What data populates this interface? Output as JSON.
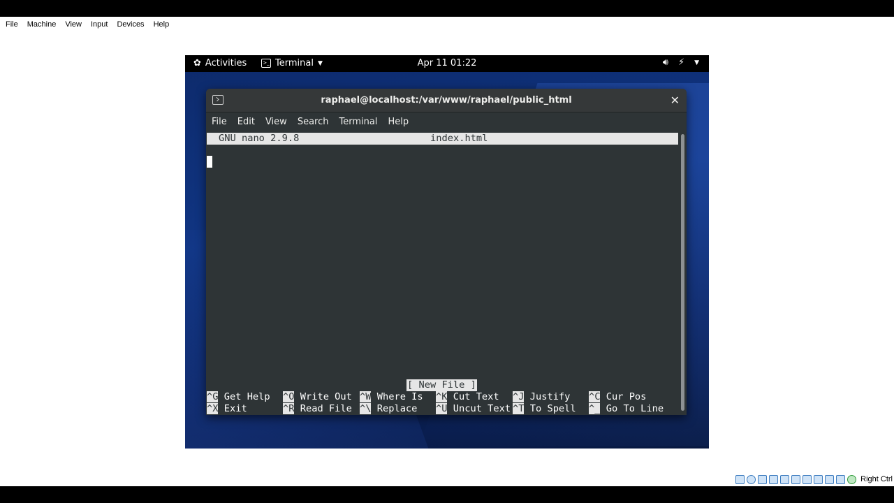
{
  "host_window": {
    "menu": [
      "File",
      "Machine",
      "View",
      "Input",
      "Devices",
      "Help"
    ],
    "status_icons": [
      "hard-disk-icon",
      "optical-drive-icon",
      "audio-icon",
      "network-icon",
      "usb-icon",
      "shared-folders-icon",
      "display-icon",
      "video-capture-icon",
      "keyboard-icon",
      "mouse-integration-icon",
      "green-indicator-icon"
    ],
    "host_key_label": "Right Ctrl"
  },
  "gnome_topbar": {
    "activities": "Activities",
    "app_menu": "Terminal",
    "clock": "Apr 11  01:22",
    "tray_icons": [
      "volume-icon",
      "power-icon",
      "dropdown-arrow-icon"
    ]
  },
  "terminal": {
    "title": "raphael@localhost:/var/www/raphael/public_html",
    "menu": [
      "File",
      "Edit",
      "View",
      "Search",
      "Terminal",
      "Help"
    ]
  },
  "nano": {
    "version": "GNU nano 2.9.8",
    "filename": "index.html",
    "status": "[ New File ]",
    "shortcuts_row1": [
      {
        "key": "^G",
        "label": "Get Help"
      },
      {
        "key": "^O",
        "label": "Write Out"
      },
      {
        "key": "^W",
        "label": "Where Is"
      },
      {
        "key": "^K",
        "label": "Cut Text"
      },
      {
        "key": "^J",
        "label": "Justify"
      },
      {
        "key": "^C",
        "label": "Cur Pos"
      }
    ],
    "shortcuts_row2": [
      {
        "key": "^X",
        "label": "Exit"
      },
      {
        "key": "^R",
        "label": "Read File"
      },
      {
        "key": "^\\",
        "label": "Replace"
      },
      {
        "key": "^U",
        "label": "Uncut Text"
      },
      {
        "key": "^T",
        "label": "To Spell"
      },
      {
        "key": "^_",
        "label": "Go To Line"
      }
    ]
  },
  "colors": {
    "terminal_bg": "#2e3436",
    "nano_bar": "#e6e6e6",
    "desktop_blue": "#103583"
  }
}
